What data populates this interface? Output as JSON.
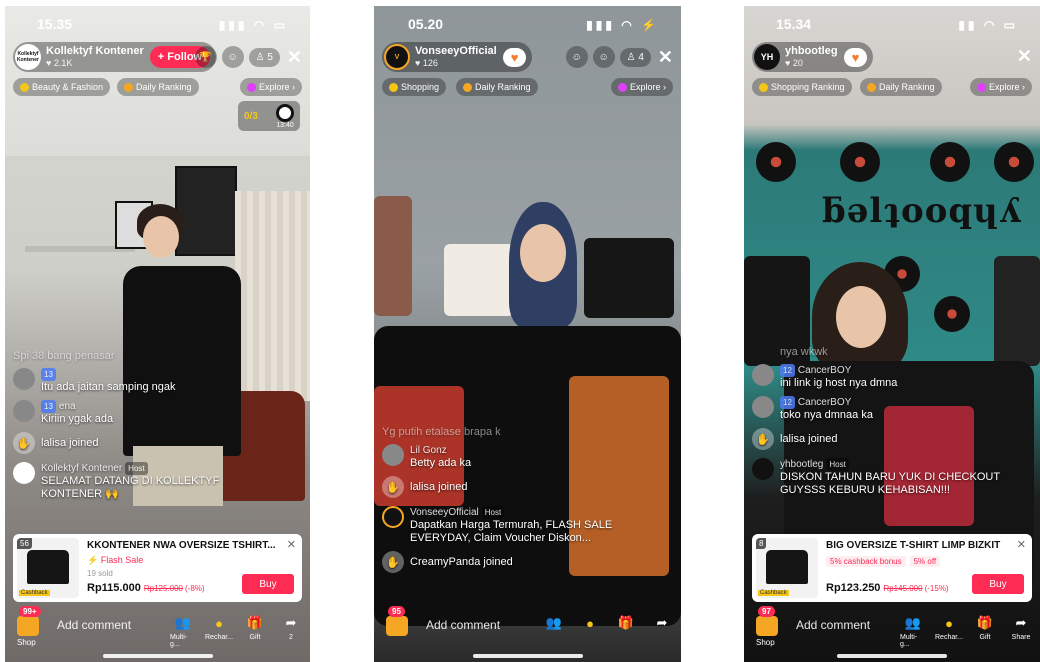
{
  "screens": [
    {
      "status": {
        "time": "15.35",
        "icons": "▮▮▮ ◠ ▭"
      },
      "host": {
        "name": "Kollektyf Kontener",
        "likes": "♥ 2.1K",
        "avatar_text": "Kollektyf Kontener"
      },
      "follow_label": "+ Follow",
      "viewers": "♙ 5",
      "close": "✕",
      "pills": [
        "Beauty & Fashion",
        "Daily Ranking",
        "Explore ›"
      ],
      "counter": "0/3",
      "counter_time": "13:40",
      "chat": [
        {
          "type": "faded",
          "text": "Spi 38 bang penasar"
        },
        {
          "type": "msg",
          "badge": "13",
          "name": "",
          "text": "Itu ada jaitan samping ngak"
        },
        {
          "type": "msg",
          "badge": "13",
          "name": "ena",
          "text": "Kiriin ygak ada"
        },
        {
          "type": "joined",
          "text": "lalisa joined"
        },
        {
          "type": "host",
          "name": "Kollektyf Kontener",
          "tag": "Host",
          "text": "SELAMAT DATANG DI KOLLEKTYF KONTENER 🙌"
        }
      ],
      "product": {
        "num": "56",
        "title": "KKONTENER NWA OVERSIZE TSHIRT...",
        "flash": "⚡ Flash Sale",
        "sold": "19 sold",
        "price": "Rp115.000",
        "old_price": "Rp125.000",
        "pct": "(-8%)",
        "buy": "Buy",
        "tag": "Cashback"
      },
      "shop_badge": "99+",
      "shop_label": "Shop",
      "comment": "Add comment",
      "actions": [
        "Multi-g...",
        "Rechar...",
        "Gift",
        "2"
      ]
    },
    {
      "status": {
        "time": "05.20",
        "icons": "▮▮▮ ◠ ⚡"
      },
      "host": {
        "name": "VonseeyOfficial",
        "likes": "♥ 126",
        "avatar_text": "V"
      },
      "viewers": "♙ 4",
      "close": "✕",
      "pills": [
        "Shopping",
        "Daily Ranking",
        "Explore ›"
      ],
      "chat": [
        {
          "type": "faded",
          "text": "Yg putih etalase brapa k"
        },
        {
          "type": "msg",
          "badge": "",
          "name": "Lil Gonz",
          "text": "Betty ada ka"
        },
        {
          "type": "joined",
          "text": "lalisa joined"
        },
        {
          "type": "host",
          "name": "VonseeyOfficial",
          "tag": "Host",
          "text": "Dapatkan Harga Termurah, FLASH SALE EVERYDAY, Claim Voucher Diskon..."
        },
        {
          "type": "joined",
          "text": "CreamyPanda joined"
        }
      ],
      "shop_badge": "95",
      "comment": "Add comment"
    },
    {
      "status": {
        "time": "15.34",
        "icons": "▮▮ ◠ ▭"
      },
      "host": {
        "name": "yhbootleg",
        "likes": "♥ 20",
        "avatar_text": "YH"
      },
      "close": "✕",
      "pills": [
        "Shopping Ranking",
        "Daily Ranking",
        "Explore ›"
      ],
      "wall_sign": "ƃəlʇooqɥʎ",
      "chat": [
        {
          "type": "faded",
          "text": "nya wkwk"
        },
        {
          "type": "msg",
          "badge": "12",
          "name": "CancerBOY",
          "text": "ini link ig host nya dmna"
        },
        {
          "type": "msg",
          "badge": "12",
          "name": "CancerBOY",
          "text": "toko nya dmnaa ka"
        },
        {
          "type": "joined",
          "text": "lalisa joined"
        },
        {
          "type": "host",
          "name": "yhbootleg",
          "tag": "Host",
          "text": "DISKON TAHUN BARU YUK DI CHECKOUT GUYSSS KEBURU KEHABISAN!!!"
        }
      ],
      "product": {
        "num": "8",
        "title": "BIG OVERSIZE T-SHIRT LIMP BIZKIT",
        "chip1": "5% cashback bonus",
        "chip2": "5% off",
        "price": "Rp123.250",
        "old_price": "Rp145.000",
        "pct": "(-15%)",
        "buy": "Buy",
        "tag": "Cashback"
      },
      "shop_badge": "97",
      "shop_label": "Shop",
      "comment": "Add comment",
      "actions": [
        "Multi-g...",
        "Rechar...",
        "Gift",
        "Share"
      ]
    }
  ],
  "colors": {
    "accent": "#fe2c55",
    "shop": "#f5a623",
    "badge": "#4b7bf5",
    "fan": "#f08030"
  }
}
